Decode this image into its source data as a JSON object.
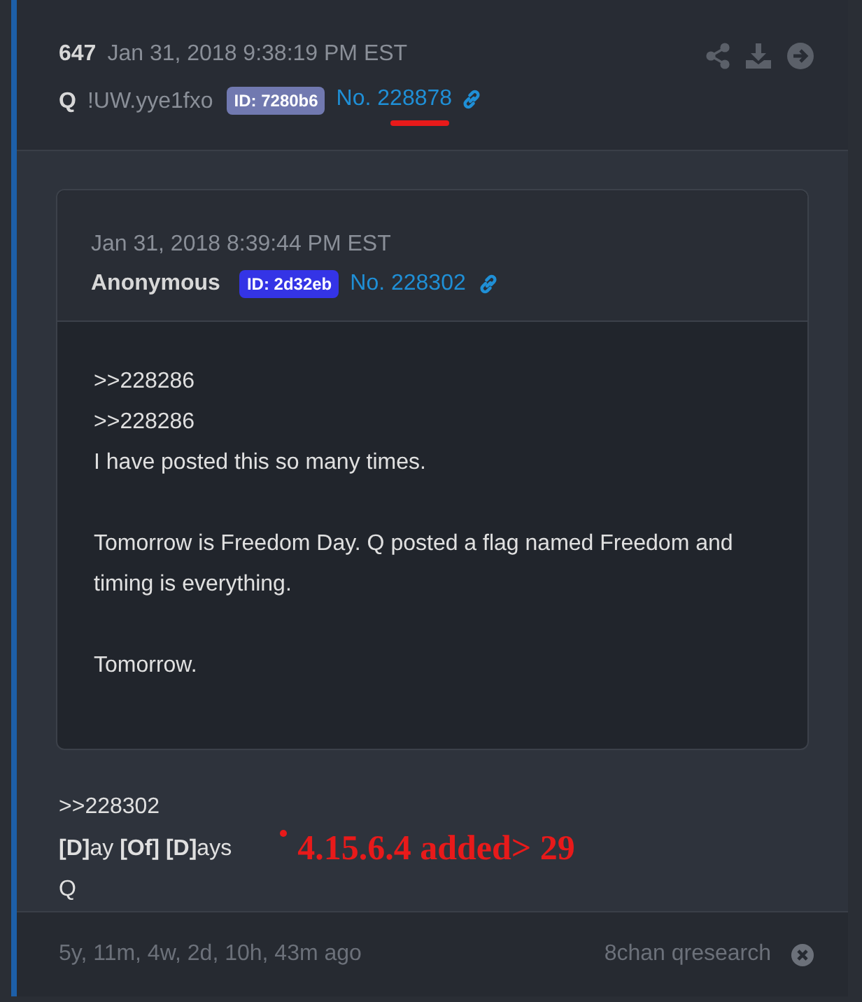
{
  "post": {
    "number": "647",
    "date": "Jan 31, 2018 9:38:19 PM EST",
    "name": "Q",
    "tripcode": "!UW.yye1fxo",
    "id_badge": {
      "text": "ID: 7280b6",
      "color": "#7179b0"
    },
    "post_no": "No. 228878",
    "quote": {
      "date": "Jan 31, 2018 8:39:44 PM EST",
      "name": "Anonymous",
      "id_badge": {
        "text": "ID: 2d32eb",
        "color": "#3434e6"
      },
      "post_no": "No. 228302",
      "paragraphs": [
        [
          ">>228286",
          ">>228286",
          "I have posted this so many times."
        ],
        [
          "Tomorrow is Freedom Day. Q posted a flag named Freedom and timing is everything."
        ],
        [
          "Tomorrow."
        ]
      ]
    },
    "body": [
      ">>228302",
      "**[D]**ay **[Of]** **[D]**ays",
      "Q"
    ],
    "annotation": "4.15.6.4 added> 29",
    "footer": {
      "elapsed": "5y, 11m, 4w, 2d, 10h, 43m ago",
      "source": "8chan qresearch"
    }
  }
}
